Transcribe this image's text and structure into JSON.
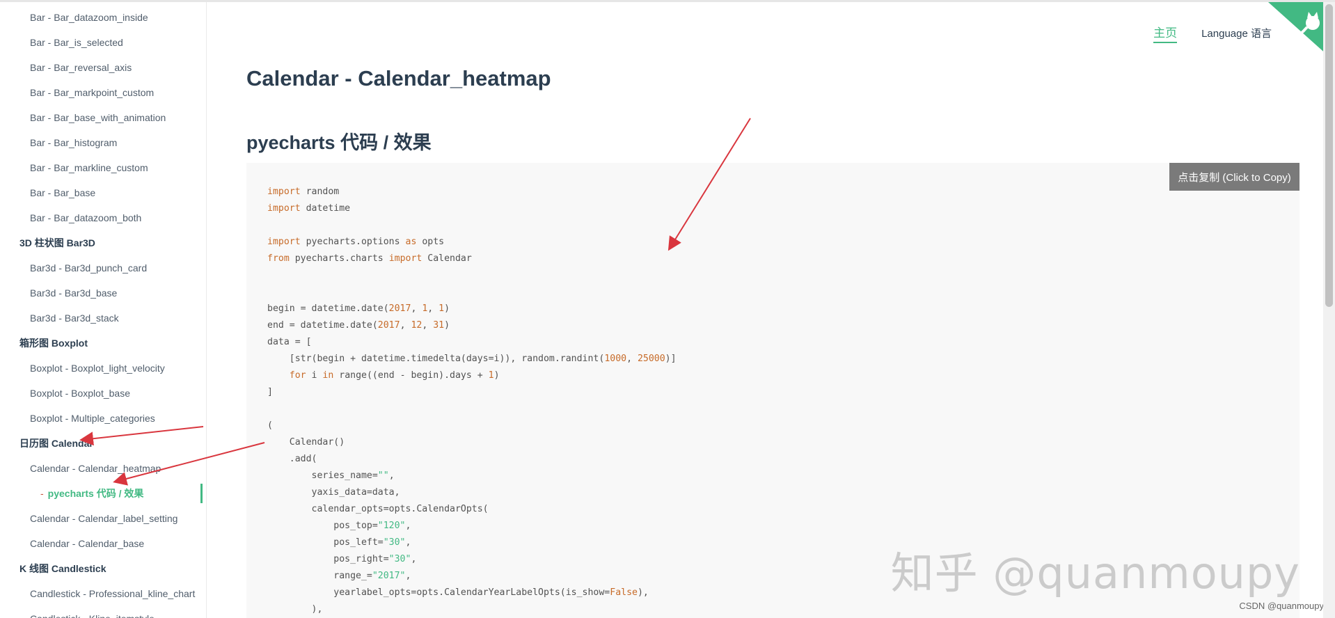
{
  "sidebar": {
    "items": [
      {
        "type": "child",
        "label": "Bar - Bar_datazoom_inside"
      },
      {
        "type": "child",
        "label": "Bar - Bar_is_selected"
      },
      {
        "type": "child",
        "label": "Bar - Bar_reversal_axis"
      },
      {
        "type": "child",
        "label": "Bar - Bar_markpoint_custom"
      },
      {
        "type": "child",
        "label": "Bar - Bar_base_with_animation"
      },
      {
        "type": "child",
        "label": "Bar - Bar_histogram"
      },
      {
        "type": "child",
        "label": "Bar - Bar_markline_custom"
      },
      {
        "type": "child",
        "label": "Bar - Bar_base"
      },
      {
        "type": "child",
        "label": "Bar - Bar_datazoom_both"
      },
      {
        "type": "group",
        "label": "3D 柱状图 Bar3D"
      },
      {
        "type": "child",
        "label": "Bar3d - Bar3d_punch_card"
      },
      {
        "type": "child",
        "label": "Bar3d - Bar3d_base"
      },
      {
        "type": "child",
        "label": "Bar3d - Bar3d_stack"
      },
      {
        "type": "group",
        "label": "箱形图 Boxplot"
      },
      {
        "type": "child",
        "label": "Boxplot - Boxplot_light_velocity"
      },
      {
        "type": "child",
        "label": "Boxplot - Boxplot_base"
      },
      {
        "type": "child",
        "label": "Boxplot - Multiple_categories"
      },
      {
        "type": "group",
        "label": "日历图 Calendar"
      },
      {
        "type": "child",
        "label": "Calendar - Calendar_heatmap"
      },
      {
        "type": "sub",
        "label": "pyecharts 代码 / 效果",
        "prefix": "-"
      },
      {
        "type": "child",
        "label": "Calendar - Calendar_label_setting"
      },
      {
        "type": "child",
        "label": "Calendar - Calendar_base"
      },
      {
        "type": "group",
        "label": "K 线图 Candlestick"
      },
      {
        "type": "child",
        "label": "Candlestick - Professional_kline_chart"
      },
      {
        "type": "child",
        "label": "Candlestick - Kline_itemstyle"
      }
    ]
  },
  "nav": {
    "home": "主页",
    "language": "Language 语言"
  },
  "main": {
    "title": "Calendar - Calendar_heatmap",
    "section_title": "pyecharts 代码 / 效果",
    "copy_button": "点击复制 (Click to Copy)"
  },
  "code_lines": [
    [
      {
        "t": "kw",
        "v": "import"
      },
      {
        "t": "p",
        "v": " random"
      }
    ],
    [
      {
        "t": "kw",
        "v": "import"
      },
      {
        "t": "p",
        "v": " datetime"
      }
    ],
    [],
    [
      {
        "t": "kw",
        "v": "import"
      },
      {
        "t": "p",
        "v": " pyecharts.options "
      },
      {
        "t": "kw",
        "v": "as"
      },
      {
        "t": "p",
        "v": " opts"
      }
    ],
    [
      {
        "t": "kw",
        "v": "from"
      },
      {
        "t": "p",
        "v": " pyecharts.charts "
      },
      {
        "t": "kw",
        "v": "import"
      },
      {
        "t": "p",
        "v": " Calendar"
      }
    ],
    [],
    [],
    [
      {
        "t": "p",
        "v": "begin = datetime.date("
      },
      {
        "t": "num",
        "v": "2017"
      },
      {
        "t": "p",
        "v": ", "
      },
      {
        "t": "num",
        "v": "1"
      },
      {
        "t": "p",
        "v": ", "
      },
      {
        "t": "num",
        "v": "1"
      },
      {
        "t": "p",
        "v": ")"
      }
    ],
    [
      {
        "t": "p",
        "v": "end = datetime.date("
      },
      {
        "t": "num",
        "v": "2017"
      },
      {
        "t": "p",
        "v": ", "
      },
      {
        "t": "num",
        "v": "12"
      },
      {
        "t": "p",
        "v": ", "
      },
      {
        "t": "num",
        "v": "31"
      },
      {
        "t": "p",
        "v": ")"
      }
    ],
    [
      {
        "t": "p",
        "v": "data = ["
      }
    ],
    [
      {
        "t": "p",
        "v": "    [str(begin + datetime.timedelta(days=i)), random.randint("
      },
      {
        "t": "num",
        "v": "1000"
      },
      {
        "t": "p",
        "v": ", "
      },
      {
        "t": "num",
        "v": "25000"
      },
      {
        "t": "p",
        "v": ")]"
      }
    ],
    [
      {
        "t": "p",
        "v": "    "
      },
      {
        "t": "kw",
        "v": "for"
      },
      {
        "t": "p",
        "v": " i "
      },
      {
        "t": "kw",
        "v": "in"
      },
      {
        "t": "p",
        "v": " range((end - begin).days + "
      },
      {
        "t": "num",
        "v": "1"
      },
      {
        "t": "p",
        "v": ")"
      }
    ],
    [
      {
        "t": "p",
        "v": "]"
      }
    ],
    [],
    [
      {
        "t": "p",
        "v": "("
      }
    ],
    [
      {
        "t": "p",
        "v": "    Calendar()"
      }
    ],
    [
      {
        "t": "p",
        "v": "    .add("
      }
    ],
    [
      {
        "t": "p",
        "v": "        series_name="
      },
      {
        "t": "str",
        "v": "\"\""
      },
      {
        "t": "p",
        "v": ","
      }
    ],
    [
      {
        "t": "p",
        "v": "        yaxis_data=data,"
      }
    ],
    [
      {
        "t": "p",
        "v": "        calendar_opts=opts.CalendarOpts("
      }
    ],
    [
      {
        "t": "p",
        "v": "            pos_top="
      },
      {
        "t": "str",
        "v": "\"120\""
      },
      {
        "t": "p",
        "v": ","
      }
    ],
    [
      {
        "t": "p",
        "v": "            pos_left="
      },
      {
        "t": "str",
        "v": "\"30\""
      },
      {
        "t": "p",
        "v": ","
      }
    ],
    [
      {
        "t": "p",
        "v": "            pos_right="
      },
      {
        "t": "str",
        "v": "\"30\""
      },
      {
        "t": "p",
        "v": ","
      }
    ],
    [
      {
        "t": "p",
        "v": "            range_="
      },
      {
        "t": "str",
        "v": "\"2017\""
      },
      {
        "t": "p",
        "v": ","
      }
    ],
    [
      {
        "t": "p",
        "v": "            yearlabel_opts=opts.CalendarYearLabelOpts(is_show="
      },
      {
        "t": "kw",
        "v": "False"
      },
      {
        "t": "p",
        "v": "),"
      }
    ],
    [
      {
        "t": "p",
        "v": "        ),"
      }
    ]
  ],
  "watermark": "知乎 @quanmoupy",
  "credit": "CSDN @quanmoupy",
  "colors": {
    "accent": "#42b983",
    "keyword": "#c76b29",
    "annotation_arrow": "#d9363e",
    "corner_badge": "#42b983"
  },
  "icons": {
    "corner": "github-octocat-icon"
  }
}
